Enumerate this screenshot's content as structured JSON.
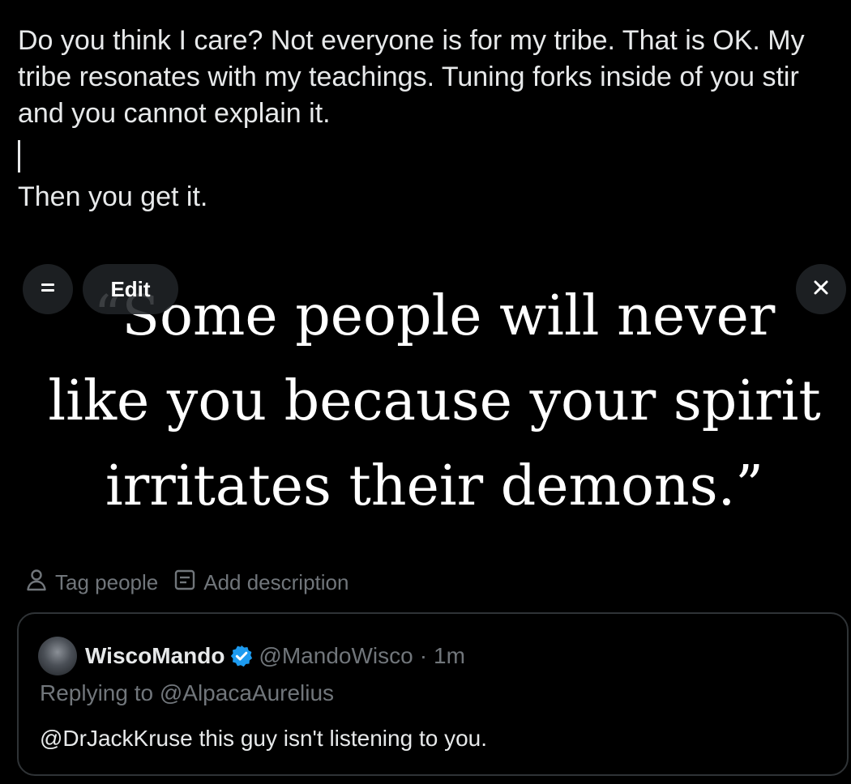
{
  "composer": {
    "paragraph1": "Do you think I care?  Not everyone is for my tribe.  That is OK.  My tribe resonates with my teachings.  Tuning forks inside of you stir and you cannot explain it.",
    "paragraph2": "Then you get it."
  },
  "media": {
    "image_lines": [
      "“Some people will never",
      "like you because your spirit",
      "irritates their demons.”"
    ],
    "edit_label": "Edit",
    "menu_icon": "equals-icon",
    "close_icon": "close-icon"
  },
  "media_actions": {
    "tag_label": "Tag people",
    "tag_icon": "person-icon",
    "description_label": "Add description",
    "description_icon": "caption-icon"
  },
  "quoted_post": {
    "display_name": "WiscoMando",
    "handle": "@MandoWisco",
    "separator": "·",
    "time": "1m",
    "replying_to": "Replying to @AlpacaAurelius",
    "body": "@DrJackKruse this guy isn't listening to you.",
    "verified_color": "#1d9bf0"
  },
  "colors": {
    "background": "#000000",
    "text": "#e7e9ea",
    "muted": "#71767b",
    "border": "#2f3336",
    "verified": "#1d9bf0"
  }
}
